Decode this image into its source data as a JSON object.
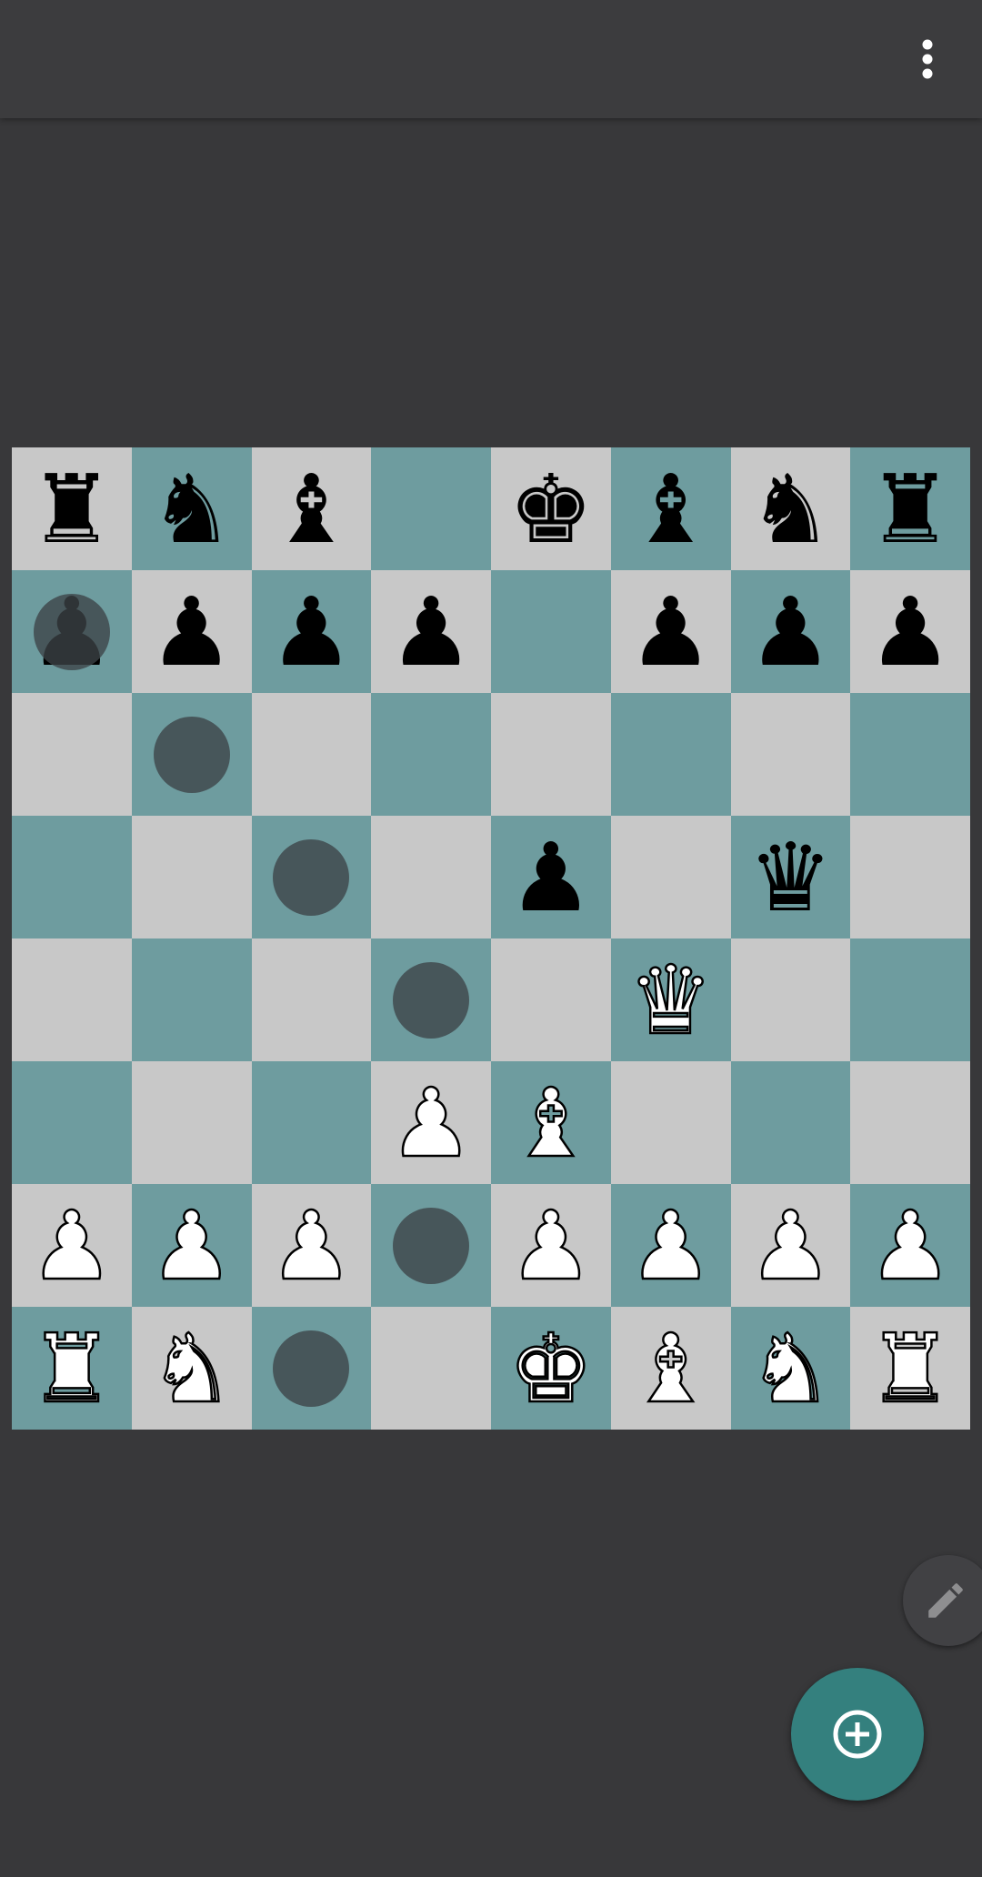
{
  "app_bar": {
    "menu_icon": "more-vert-icon"
  },
  "board": {
    "light_color": "#c8c8c8",
    "dark_color": "#6e9c9f",
    "orientation": "white-bottom",
    "ranks": [
      [
        "br",
        "bn",
        "bb",
        "",
        "bk",
        "bb",
        "bn",
        "br"
      ],
      [
        "bp",
        "bp",
        "bp",
        "bp",
        "",
        "bp",
        "bp",
        "bp"
      ],
      [
        "",
        "",
        "",
        "",
        "",
        "",
        "",
        ""
      ],
      [
        "",
        "",
        "",
        "",
        "bp",
        "",
        "bq",
        ""
      ],
      [
        "",
        "",
        "",
        "",
        "",
        "wq",
        "",
        ""
      ],
      [
        "",
        "",
        "",
        "wp",
        "wb",
        "",
        "",
        ""
      ],
      [
        "wp",
        "wp",
        "wp",
        "",
        "wp",
        "wp",
        "wp",
        "wp"
      ],
      [
        "wr",
        "wn",
        "",
        "",
        "wk",
        "wb",
        "wn",
        "wr"
      ]
    ],
    "move_markers": [
      "a7",
      "b6",
      "c5",
      "d4",
      "d2",
      "c1"
    ]
  },
  "fabs": {
    "edit_icon": "pencil-icon",
    "add_icon": "add-circle-icon",
    "add_color": "#34807e"
  }
}
